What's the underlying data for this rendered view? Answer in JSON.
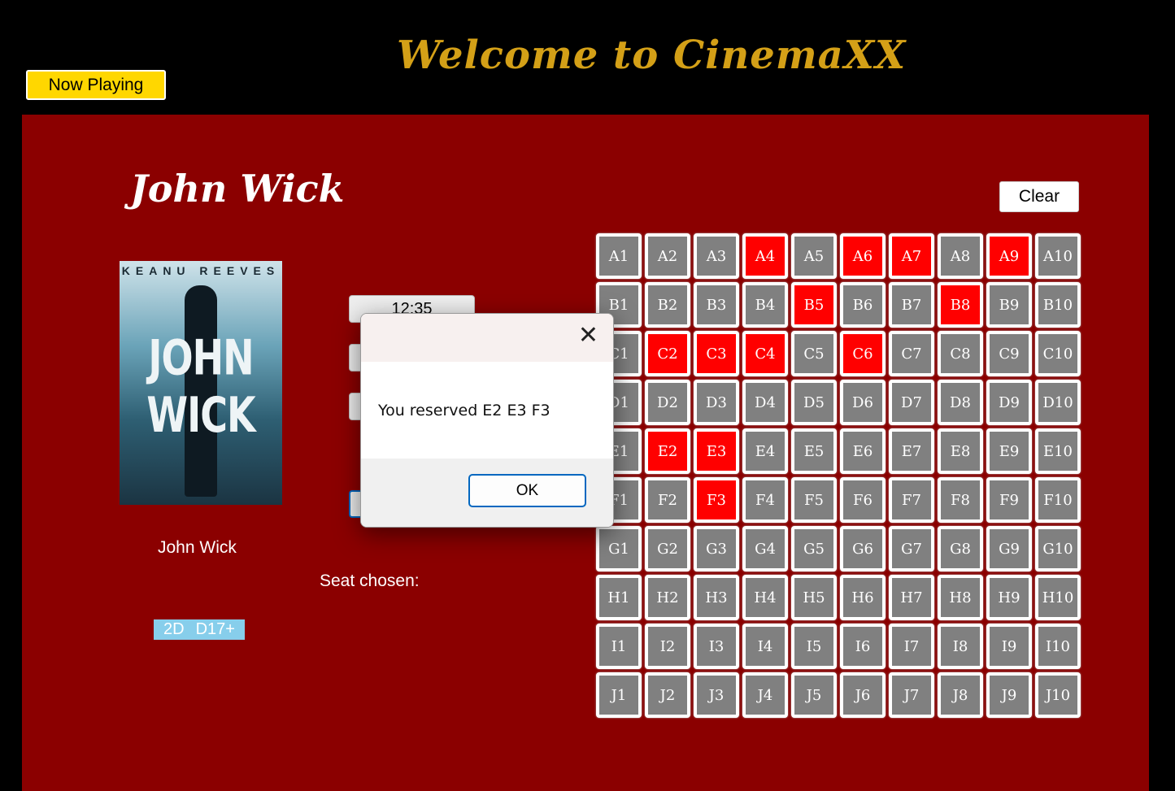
{
  "header": {
    "title": "Welcome to CinemaXX",
    "now_playing_label": "Now Playing"
  },
  "movie": {
    "title": "John Wick",
    "name": "John Wick",
    "poster": {
      "actor": "KEANU REEVES",
      "title": "JOHN WICK"
    },
    "format": "2D",
    "rating": "D17+"
  },
  "clear_label": "Clear",
  "showtimes": [
    "12:35"
  ],
  "seat_chosen_label": "Seat chosen:",
  "seat_rows": [
    "A",
    "B",
    "C",
    "D",
    "E",
    "F",
    "G",
    "H",
    "I",
    "J"
  ],
  "seat_cols": 10,
  "reserved_seats": [
    "A4",
    "A6",
    "A7",
    "A9",
    "B5",
    "B8",
    "C2",
    "C3",
    "C4",
    "C6",
    "E2",
    "E3",
    "F3"
  ],
  "colors": {
    "available": "#808080",
    "reserved": "#ff0000",
    "panel": "#8b0000",
    "title": "#d4a017",
    "now_playing": "#ffd700",
    "badge": "#87ceeb"
  },
  "dialog": {
    "message": "You reserved E2 E3 F3",
    "ok_label": "OK",
    "close_icon": "close-icon"
  }
}
